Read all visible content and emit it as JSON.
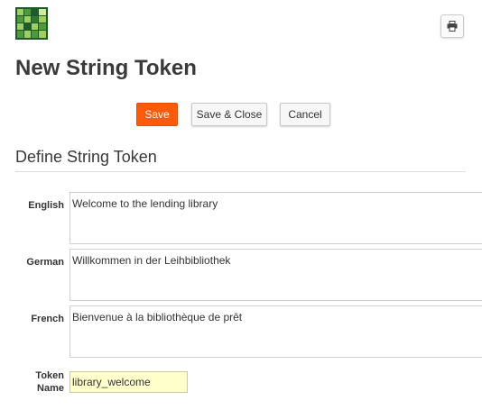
{
  "logo": {
    "icon": "grid-logo-icon",
    "colors": {
      "dark": "#1f5a2a",
      "mid": "#4e9a3a",
      "light": "#9fd05e",
      "pale": "#d4ea9a"
    }
  },
  "header": {
    "print_icon": "printer-icon",
    "title": "New String Token"
  },
  "toolbar": {
    "save_label": "Save",
    "save_close_label": "Save & Close",
    "cancel_label": "Cancel",
    "save_color": "#ff5a0a"
  },
  "section": {
    "title": "Define String Token"
  },
  "form": {
    "fields": [
      {
        "label": "English",
        "value": "Welcome to the lending library"
      },
      {
        "label": "German",
        "value": "Willkommen in der Leihbibliothek"
      },
      {
        "label": "French",
        "value": "Bienvenue à la bibliothèque de prêt"
      }
    ],
    "token_name": {
      "label_line1": "Token",
      "label_line2": "Name",
      "value": "library_welcome",
      "highlight_color": "#ffffcc"
    }
  }
}
